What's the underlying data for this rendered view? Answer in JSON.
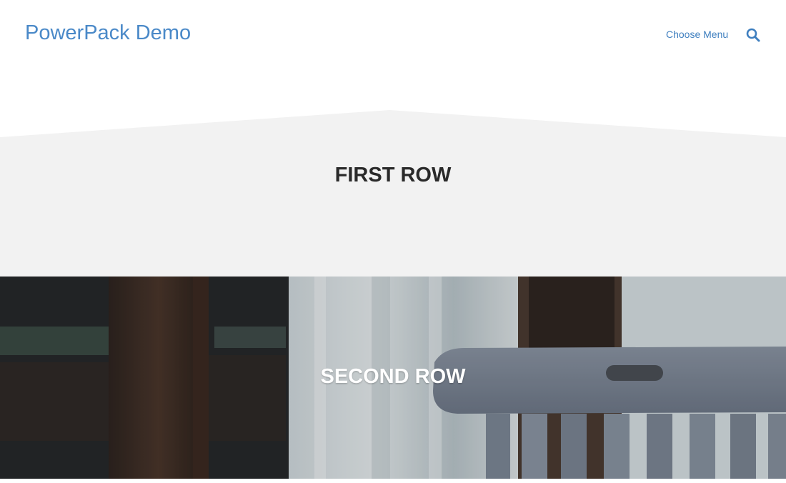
{
  "header": {
    "site_title": "PowerPack Demo",
    "menu_label": "Choose Menu",
    "search_icon": "search-icon"
  },
  "rows": {
    "first": {
      "title": "FIRST ROW"
    },
    "second": {
      "title": "SECOND ROW"
    }
  },
  "colors": {
    "accent": "#4a89c8",
    "first_row_bg": "#f2f2f2",
    "heading": "#2a2a2a"
  }
}
